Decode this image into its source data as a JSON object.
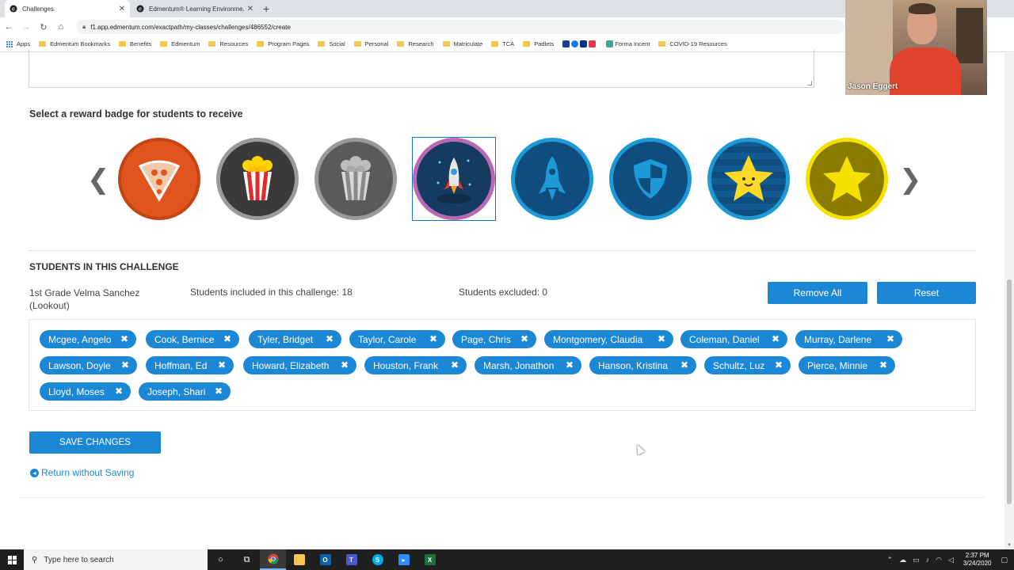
{
  "browser": {
    "tabs": [
      {
        "title": "Challenges",
        "active": true
      },
      {
        "title": "Edmentum® Learning Environme...",
        "active": false
      }
    ],
    "url": "f1.app.edmentum.com/exactpath/my-classes/challenges/486552/create",
    "bookmarks": [
      "Apps",
      "Edmentum Bookmarks",
      "Benefits",
      "Edmentum",
      "Resources",
      "Program Pages",
      "Social",
      "Personal",
      "Research",
      "Matriculate",
      "TCA",
      "Padlets",
      "Forma Incent",
      "COVID-19 Resources"
    ]
  },
  "reward": {
    "label": "Select a reward badge for students to receive",
    "badges": [
      {
        "name": "pizza-badge",
        "color": "#e0541f",
        "selected": false
      },
      {
        "name": "popcorn-color-badge",
        "color": "#3a3a3a",
        "selected": false
      },
      {
        "name": "popcorn-gray-badge",
        "color": "#5a5a5a",
        "selected": false
      },
      {
        "name": "rocket-launch-badge",
        "color": "#153b5e",
        "selected": true
      },
      {
        "name": "rocket-blue-badge",
        "color": "#0e4d7d",
        "selected": false
      },
      {
        "name": "shield-badge",
        "color": "#0e4d7d",
        "selected": false
      },
      {
        "name": "smiley-star-badge",
        "color": "#0e4d7d",
        "selected": false
      },
      {
        "name": "gold-star-badge",
        "color": "#8a7a00",
        "selected": false
      }
    ]
  },
  "students": {
    "heading": "STUDENTS IN THIS CHALLENGE",
    "class_name": "1st Grade Velma Sanchez (Lookout)",
    "included_text": "Students included in this challenge: 18",
    "excluded_text": "Students excluded: 0",
    "remove_all_label": "Remove All",
    "reset_label": "Reset",
    "names": [
      "Mcgee, Angelo",
      "Cook, Bernice",
      "Tyler, Bridget",
      "Taylor, Carole",
      "Page, Chris",
      "Montgomery, Claudia",
      "Coleman, Daniel",
      "Murray, Darlene",
      "Lawson, Doyle",
      "Hoffman, Ed",
      "Howard, Elizabeth",
      "Houston, Frank",
      "Marsh, Jonathon",
      "Hanson, Kristina",
      "Schultz, Luz",
      "Pierce, Minnie",
      "Lloyd, Moses",
      "Joseph, Shari"
    ]
  },
  "actions": {
    "save_label": "SAVE CHANGES",
    "return_label": "Return without Saving"
  },
  "webcam": {
    "name": "Jason Eggert"
  },
  "taskbar": {
    "search_placeholder": "Type here to search",
    "time": "2:37 PM",
    "date": "3/24/2020"
  }
}
